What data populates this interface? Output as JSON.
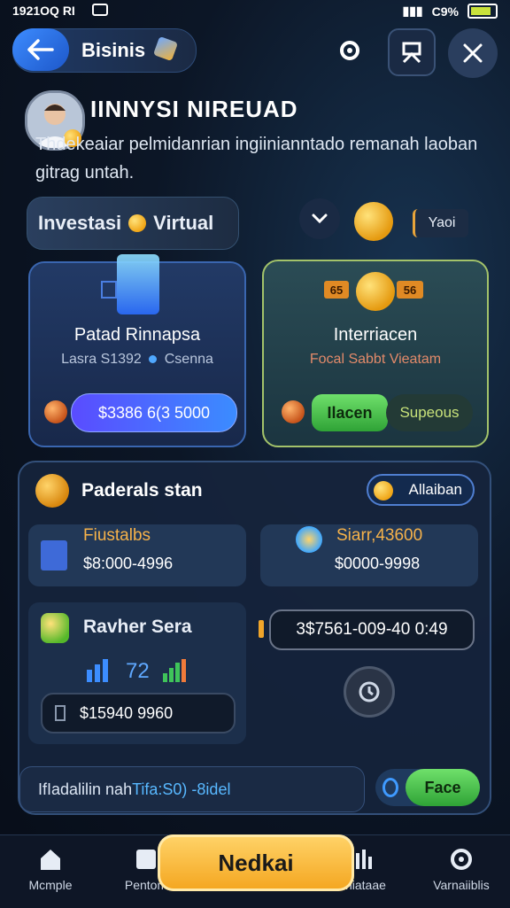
{
  "status_bar": {
    "time": "1921OQ RI",
    "battery": "C9%"
  },
  "header": {
    "title": "Bisinis"
  },
  "profile": {
    "headline": "IINNYSI NIREUAD",
    "description": "Thdekeaiar pelmidanrian ingiinianntado remanah laoban gitrag untah."
  },
  "invest": {
    "label_left": "Investasi",
    "label_right": "Virtual",
    "tag": "Yaoi"
  },
  "card_left": {
    "title": "Patad Rinnapsa",
    "sub_left": "Lasra S1392",
    "sub_right": "Csenna",
    "amount": "$3386 6(3 5000"
  },
  "card_right": {
    "badge_left": "65",
    "badge_right": "56",
    "title": "Interriacen",
    "sub": "Focal Sabbt Vieatam",
    "action": "Ilacen",
    "status": "Supeous"
  },
  "panel": {
    "title": "Paderals stan",
    "alert": "Allaiban",
    "box1": {
      "label": "Fiustalbs",
      "value": "$8:000-4996"
    },
    "box2": {
      "label": "Siarr,43600",
      "value": "$0000-9998"
    },
    "row_title": "Ravher Sera",
    "range": "3$7561-009-40 0:49",
    "metric": "72",
    "balance": "$15940 9960"
  },
  "bottom": {
    "text_left": "IfIadalilin nah ",
    "text_right": "Tifa:S0) -8idel",
    "face": "Face"
  },
  "nav": {
    "items": [
      "Mcmple",
      "Pentom",
      "Iniataae",
      "Varnaiiblis"
    ],
    "cta": "Nedkai"
  }
}
